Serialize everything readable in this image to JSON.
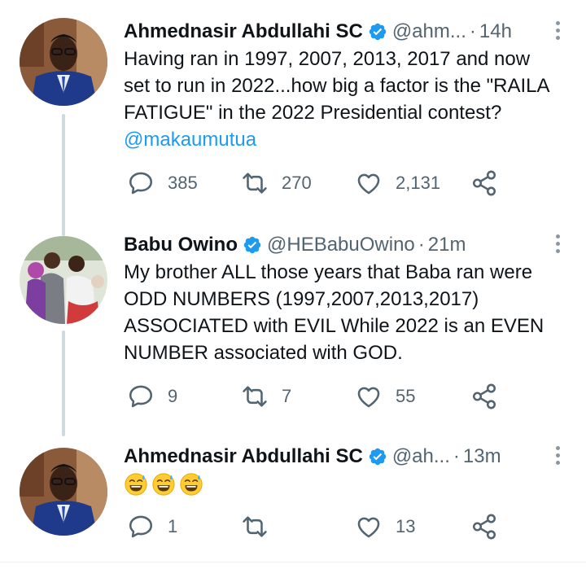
{
  "tweets": [
    {
      "name": "Ahmednasir Abdullahi SC",
      "handle": "@ahm...",
      "time": "14h",
      "text": "Having ran in 1997, 2007, 2013, 2017 and now set to run in 2022...how big a factor is the \"RAILA FATIGUE\" in the 2022 Presidential contest?",
      "mention": "@makaumutua",
      "replies": "385",
      "retweets": "270",
      "likes": "2,131"
    },
    {
      "name": "Babu Owino",
      "handle": "@HEBabuOwino",
      "time": "21m",
      "text": "My brother ALL those years that Baba ran were ODD NUMBERS (1997,2007,2013,2017) ASSOCIATED with EVIL While 2022 is an EVEN NUMBER associated with GOD.",
      "replies": "9",
      "retweets": "7",
      "likes": "55"
    },
    {
      "name": "Ahmednasir Abdullahi SC",
      "handle": "@ah...",
      "time": "13m",
      "emojis": "😅😅😅",
      "replies": "1",
      "retweets": "",
      "likes": "13"
    }
  ],
  "separator": "·",
  "colors": {
    "verified": "#1d9bf0",
    "mention": "#1d9bf0",
    "secondary": "#536471"
  },
  "icons": [
    "reply-icon",
    "retweet-icon",
    "like-icon",
    "share-icon",
    "verified-badge-icon",
    "more-icon"
  ]
}
